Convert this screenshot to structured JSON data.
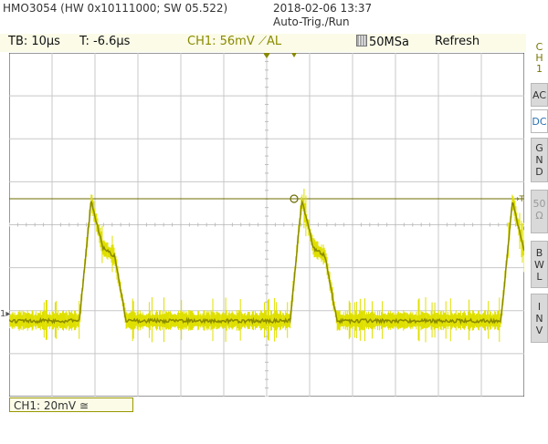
{
  "header": {
    "device": "HMO3054 (HW 0x10111000; SW 05.522)",
    "datetime": "2018-02-06 13:37",
    "mode": "Auto-Trig./Run"
  },
  "statusbar": {
    "timebase": "TB: 10µs",
    "trigger_time": "T: -6.6µs",
    "trigger_setting": "CH1: 56mV ⟋AL",
    "sample_rate": "50MSa",
    "refresh": "Refresh"
  },
  "sidebar": {
    "channel_label": [
      "C",
      "H",
      "1"
    ],
    "buttons": [
      {
        "lines": [
          "AC"
        ],
        "color": "#555555"
      },
      {
        "lines": [
          "DC"
        ],
        "color": "#2a6fb0"
      },
      {
        "lines": [
          "G",
          "N",
          "D"
        ],
        "color": "#333333"
      },
      {
        "lines": [
          "50",
          "Ω"
        ],
        "color": "#999999"
      },
      {
        "lines": [
          "B",
          "W",
          "L"
        ],
        "color": "#333333"
      },
      {
        "lines": [
          "I",
          "N",
          "V"
        ],
        "color": "#333333"
      }
    ]
  },
  "channel_box": "CH1: 20mV ≅",
  "waveform": {
    "color": "#e0e000",
    "core_color": "#8a8a00",
    "trigger_level_color": "#6b6b00",
    "baseline_level": 0.0,
    "pulse_level": 2.8
  },
  "chart_data": {
    "type": "line",
    "title": "",
    "xlabel": "",
    "ylabel": "",
    "x_divisions": 12,
    "y_divisions": 8,
    "series": [
      {
        "values": [
          0,
          0,
          0,
          0,
          0,
          0,
          0,
          2.8,
          1.7,
          1.5,
          0,
          0,
          0,
          0,
          0,
          0,
          0,
          0,
          0,
          0,
          0,
          0,
          0,
          0,
          0,
          2.8,
          1.7,
          1.5,
          0,
          0,
          0,
          0,
          0,
          0,
          0,
          0,
          0,
          0,
          0,
          0,
          0,
          0,
          0,
          2.8,
          1.6
        ]
      }
    ]
  }
}
